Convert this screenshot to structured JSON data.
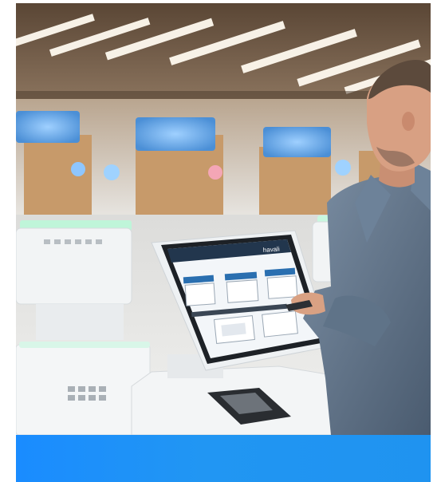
{
  "photo": {
    "subject": "airport-self-service-kiosk",
    "kiosk_brand_text": "havali",
    "colors": {
      "ceiling": "#6f5a46",
      "counter_wood": "#c79a6a",
      "screen_glow": "#59a7e8",
      "jacket_denim": "#5d7187",
      "kiosk_white": "#eef1f3",
      "kiosk_screen": "#f3f6f9",
      "kiosk_accent": "#2a6fb0"
    }
  },
  "banner": {
    "color": "#1f93f0"
  }
}
